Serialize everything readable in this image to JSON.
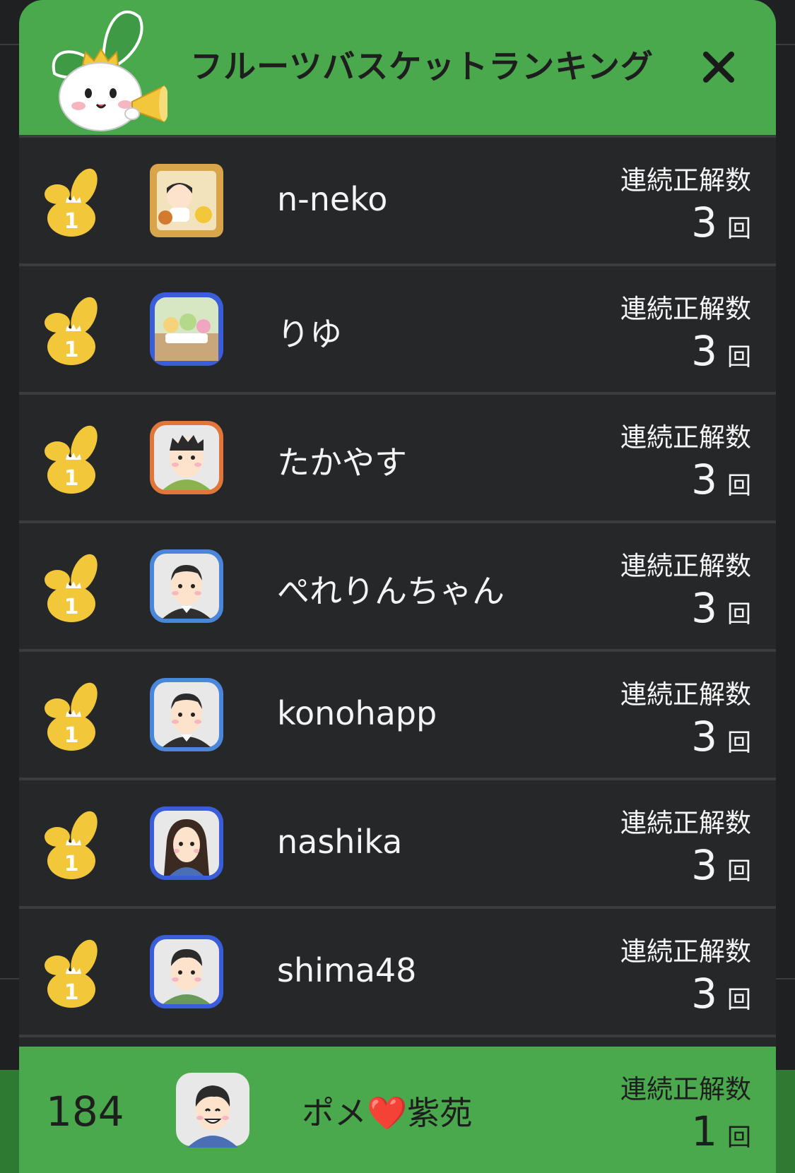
{
  "header": {
    "title": "フルーツバスケットランキング",
    "close_icon": "close-icon",
    "mascot_icon": "crowned-rabbit-megaphone-icon"
  },
  "rankings": [
    {
      "rank": "1",
      "username": "n-neko",
      "stat_label": "連続正解数",
      "stat_value": "3",
      "stat_unit": "回",
      "avatar": "woman-with-dogs-frame",
      "avatar_border": "#d9a54a"
    },
    {
      "rank": "1",
      "username": "りゆ",
      "stat_label": "連続正解数",
      "stat_value": "3",
      "stat_unit": "回",
      "avatar": "toy-figures-photo",
      "avatar_border": "#3a5ed9"
    },
    {
      "rank": "1",
      "username": "たかやす",
      "stat_label": "連続正解数",
      "stat_value": "3",
      "stat_unit": "回",
      "avatar": "man-spiky-hair",
      "avatar_border": "#e0763a"
    },
    {
      "rank": "1",
      "username": "ぺれりんちゃん",
      "stat_label": "連続正解数",
      "stat_value": "3",
      "stat_unit": "回",
      "avatar": "man-suit",
      "avatar_border": "#4a86d9"
    },
    {
      "rank": "1",
      "username": "konohapp",
      "stat_label": "連続正解数",
      "stat_value": "3",
      "stat_unit": "回",
      "avatar": "man-suit",
      "avatar_border": "#4a86d9"
    },
    {
      "rank": "1",
      "username": "nashika",
      "stat_label": "連続正解数",
      "stat_value": "3",
      "stat_unit": "回",
      "avatar": "woman-long-hair",
      "avatar_border": "#3a5ed9"
    },
    {
      "rank": "1",
      "username": "shima48",
      "stat_label": "連続正解数",
      "stat_value": "3",
      "stat_unit": "回",
      "avatar": "man-green-shirt",
      "avatar_border": "#3a5ed9"
    }
  ],
  "my_entry": {
    "rank": "184",
    "username": "ポメ❤️紫苑",
    "stat_label": "連続正解数",
    "stat_value": "1",
    "stat_unit": "回",
    "avatar": "smiling-boy"
  },
  "colors": {
    "header_green": "#4aa84d",
    "row_bg": "#262728",
    "badge_gold": "#f2c73a"
  }
}
